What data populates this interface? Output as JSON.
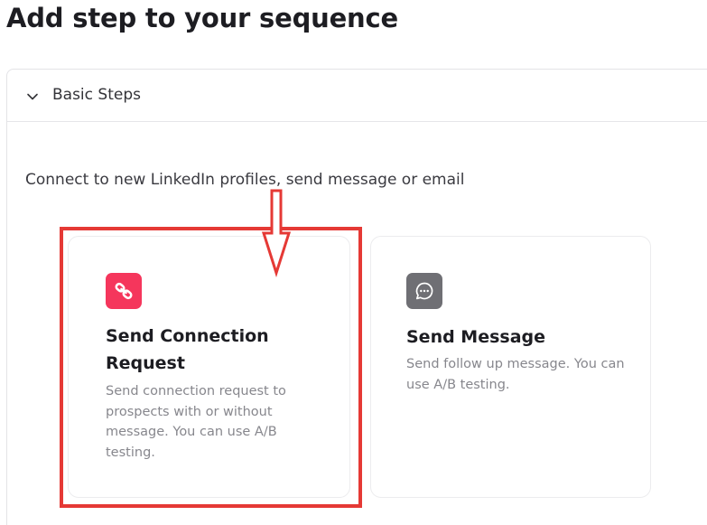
{
  "page": {
    "title": "Add step to your sequence"
  },
  "accordion": {
    "label": "Basic Steps",
    "expanded": true,
    "icon": "chevron-down-icon"
  },
  "section": {
    "description": "Connect to new LinkedIn profiles, send message or email"
  },
  "steps": [
    {
      "title": "Send Connection Request",
      "description": "Send connection request to prospects with or without message. You can use A/B testing.",
      "icon": "link-icon",
      "icon_color": "#f5365c"
    },
    {
      "title": "Send Message",
      "description": "Send follow up message. You can use A/B testing.",
      "icon": "chat-bubble-icon",
      "icon_color": "#6f6f74"
    }
  ],
  "annotation": {
    "highlight_color": "#e53935"
  }
}
